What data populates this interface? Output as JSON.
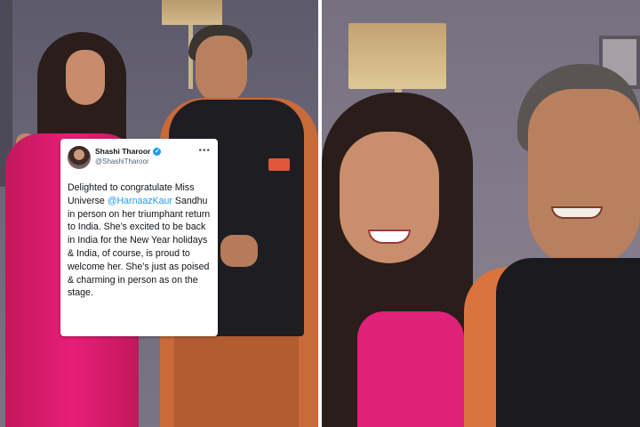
{
  "tweet": {
    "author_name": "Shashi Tharoor",
    "author_handle": "@ShashiTharoor",
    "more_icon": "ellipsis-icon",
    "verified_icon": "verified-badge-icon",
    "text_before": "Delighted to congratulate Miss Universe ",
    "mention": "@HarnaazKaur",
    "text_after": " Sandhu in person on her triumphant return to India. She’s excited to be back in India for the New Year holidays & India, of course, is proud to welcome her. She’s just as poised & charming in person as on the stage.",
    "colors": {
      "mention": "#1d9bf0",
      "text": "#0f1419",
      "secondary": "#536471"
    }
  }
}
